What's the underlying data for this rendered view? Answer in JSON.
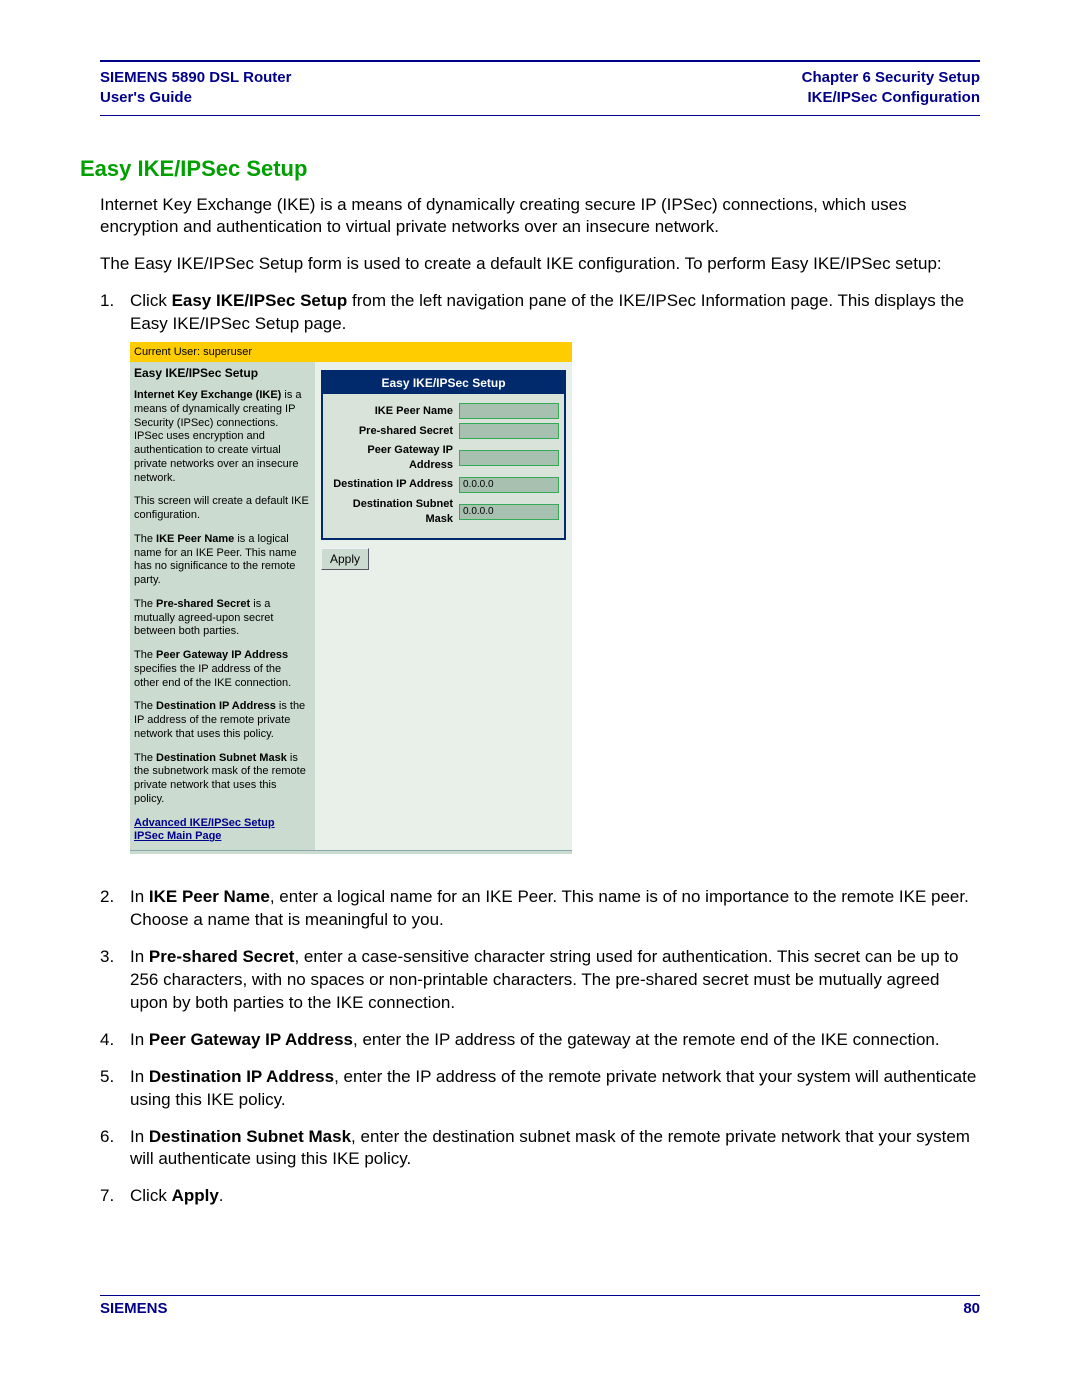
{
  "header": {
    "left_line1": "SIEMENS 5890 DSL Router",
    "left_line2": "User's Guide",
    "right_line1": "Chapter 6  Security Setup",
    "right_line2": "IKE/IPSec Configuration"
  },
  "section_heading": "Easy IKE/IPSec Setup",
  "intro_para1": "Internet Key Exchange (IKE) is a means of dynamically creating secure IP (IPSec) connections, which uses encryption and authentication to virtual private networks over an insecure network.",
  "intro_para2": "The Easy IKE/IPSec Setup form is used to create a default IKE configuration. To perform Easy IKE/IPSec setup:",
  "steps": {
    "s1_num": "1.",
    "s1_pre": "Click ",
    "s1_bold": "Easy IKE/IPSec Setup",
    "s1_post": " from the left navigation pane of the IKE/IPSec Information page. This displays the Easy IKE/IPSec Setup page.",
    "s2_num": "2.",
    "s2_pre": "In ",
    "s2_bold": "IKE Peer Name",
    "s2_post": ", enter a logical name for an IKE Peer. This name is of no importance to the remote IKE peer. Choose a name that is meaningful to you.",
    "s3_num": "3.",
    "s3_pre": "In ",
    "s3_bold": "Pre-shared Secret",
    "s3_post": ", enter a case-sensitive character string used for authentication. This secret can be up to 256 characters, with no spaces or non-printable characters. The pre-shared secret must be mutually agreed upon by both parties to the IKE connection.",
    "s4_num": "4.",
    "s4_pre": "In ",
    "s4_bold": "Peer Gateway IP Address",
    "s4_post": ", enter the IP address of the gateway at the remote end of the IKE connection.",
    "s5_num": "5.",
    "s5_pre": "In ",
    "s5_bold": "Destination IP Address",
    "s5_post": ", enter the IP address of the remote private network that your system will authenticate using this IKE policy.",
    "s6_num": "6.",
    "s6_pre": "In ",
    "s6_bold": "Destination Subnet Mask",
    "s6_post": ", enter the destination subnet mask of the remote private network that your system will authenticate using this IKE policy.",
    "s7_num": "7.",
    "s7_pre": "Click ",
    "s7_bold": "Apply",
    "s7_post": "."
  },
  "shot": {
    "current_user": "Current User: superuser",
    "left_heading": "Easy IKE/IPSec Setup",
    "p1a": "Internet Key Exchange (IKE)",
    "p1b": " is a means of dynamically creating IP Security (IPSec) connections. IPSec uses encryption and authentication to create virtual private networks over an insecure network.",
    "p2": "This screen will create a default IKE configuration.",
    "p3a": "The ",
    "p3b": "IKE Peer Name",
    "p3c": " is a logical name for an IKE Peer. This name has no significance to the remote party.",
    "p4a": "The ",
    "p4b": "Pre-shared Secret",
    "p4c": " is a mutually agreed-upon secret between both parties.",
    "p5a": "The ",
    "p5b": "Peer Gateway IP Address",
    "p5c": " specifies the IP address of the other end of the IKE connection.",
    "p6a": "The ",
    "p6b": "Destination IP Address",
    "p6c": " is the IP address of the remote private network that uses this policy.",
    "p7a": "The ",
    "p7b": "Destination Subnet Mask",
    "p7c": " is the subnetwork mask of the remote private network that uses this policy.",
    "link1": "Advanced IKE/IPSec Setup",
    "link2": "IPSec Main Page",
    "form_title": "Easy IKE/IPSec Setup",
    "fields": {
      "peer_name_label": "IKE Peer Name",
      "peer_name_value": "",
      "secret_label": "Pre-shared Secret",
      "secret_value": "",
      "gateway_label": "Peer Gateway IP Address",
      "gateway_value": "",
      "dest_ip_label": "Destination IP Address",
      "dest_ip_value": "0.0.0.0",
      "dest_mask_label": "Destination Subnet Mask",
      "dest_mask_value": "0.0.0.0"
    },
    "apply_button": "Apply"
  },
  "footer": {
    "brand": "SIEMENS",
    "page": "80"
  }
}
